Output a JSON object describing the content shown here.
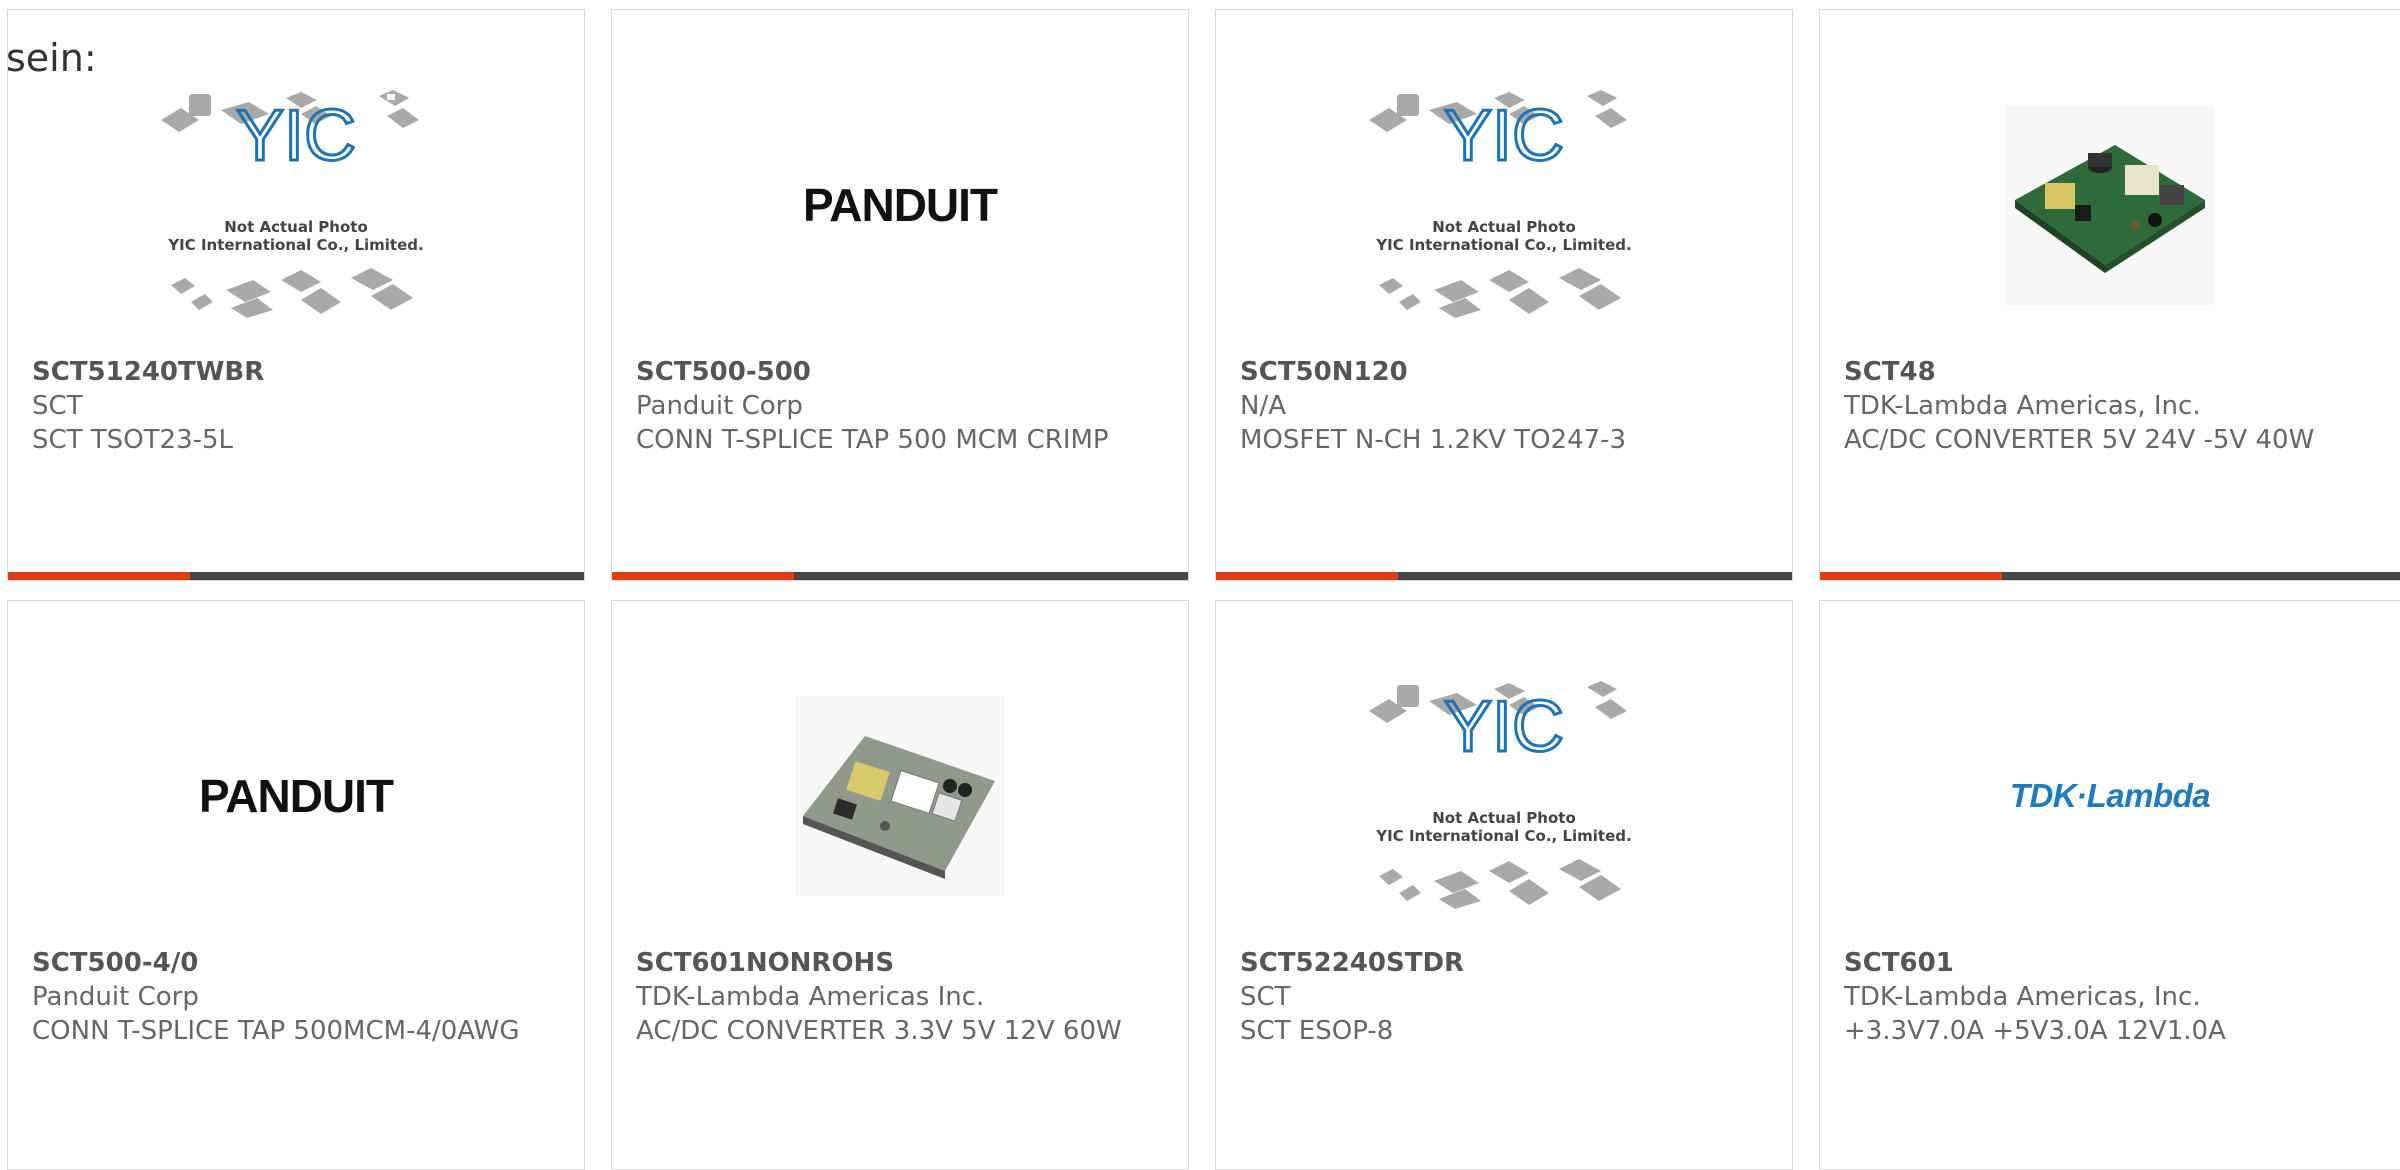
{
  "intro_text": "sein:",
  "accent_color": "#e13d12",
  "products": [
    {
      "part_number": "SCT51240TWBR",
      "manufacturer": "SCT",
      "description": "SCT TSOT23-5L",
      "image": "yic-placeholder",
      "caption_1": "Not Actual Photo",
      "caption_2": "YIC International Co., Limited."
    },
    {
      "part_number": "SCT500-500",
      "manufacturer": "Panduit Corp",
      "description": "CONN T-SPLICE TAP 500 MCM CRIMP",
      "image": "panduit-logo",
      "logo_text": "PANDUIT"
    },
    {
      "part_number": "SCT50N120",
      "manufacturer": "N/A",
      "description": "MOSFET N-CH 1.2KV TO247-3",
      "image": "yic-placeholder",
      "caption_1": "Not Actual Photo",
      "caption_2": "YIC International Co., Limited."
    },
    {
      "part_number": "SCT48",
      "manufacturer": "TDK-Lambda Americas, Inc.",
      "description": "AC/DC CONVERTER 5V 24V -5V 40W",
      "image": "pcb-photo"
    },
    {
      "part_number": "SCT500-4/0",
      "manufacturer": "Panduit Corp",
      "description": "CONN T-SPLICE TAP 500MCM-4/0AWG",
      "image": "panduit-logo",
      "logo_text": "PANDUIT"
    },
    {
      "part_number": "SCT601NONROHS",
      "manufacturer": "TDK-Lambda Americas Inc.",
      "description": "AC/DC CONVERTER 3.3V 5V 12V 60W",
      "image": "pcb-photo"
    },
    {
      "part_number": "SCT52240STDR",
      "manufacturer": "SCT",
      "description": "SCT ESOP-8",
      "image": "yic-placeholder",
      "caption_1": "Not Actual Photo",
      "caption_2": "YIC International Co., Limited."
    },
    {
      "part_number": "SCT601",
      "manufacturer": "TDK-Lambda Americas, Inc.",
      "description": "+3.3V7.0A +5V3.0A 12V1.0A",
      "image": "tdk-lambda-logo",
      "logo_text": "TDK·Lambda"
    }
  ]
}
